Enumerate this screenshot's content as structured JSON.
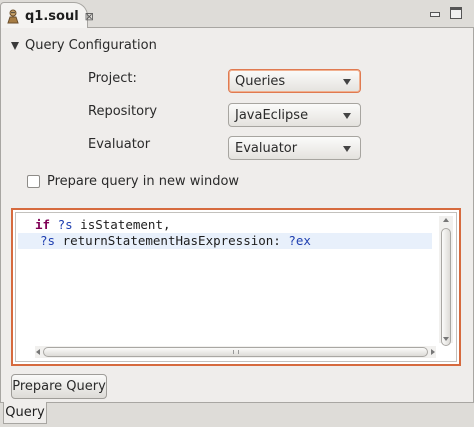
{
  "editor_tab": {
    "title": "q1.soul",
    "icon": "soul-file-icon",
    "close_glyph": "⊠"
  },
  "window_controls": {
    "minimize_icon": "minimize-icon",
    "maximize_icon": "maximize-icon"
  },
  "section": {
    "title": "Query Configuration",
    "expanded": true
  },
  "form": {
    "project_label": "Project:",
    "project_value": "Queries",
    "repository_label": "Repository",
    "repository_value": "JavaEclipse",
    "evaluator_label": "Evaluator",
    "evaluator_value": "Evaluator",
    "new_window_label": "Prepare query in new window",
    "new_window_checked": false
  },
  "editor": {
    "line1": {
      "kw": "if",
      "var": "?s",
      "rest": " isStatement,"
    },
    "line2": {
      "var": "?s",
      "rest": " returnStatementHasExpression: ",
      "var2": "?ex"
    }
  },
  "actions": {
    "prepare_label": "Prepare Query"
  },
  "bottom_tabs": [
    {
      "label": "Query"
    }
  ],
  "colors": {
    "focus_accent": "#d66a3e",
    "keyword": "#7f0055",
    "variable": "#1f3fb0",
    "current_line": "#e8f0fb"
  }
}
